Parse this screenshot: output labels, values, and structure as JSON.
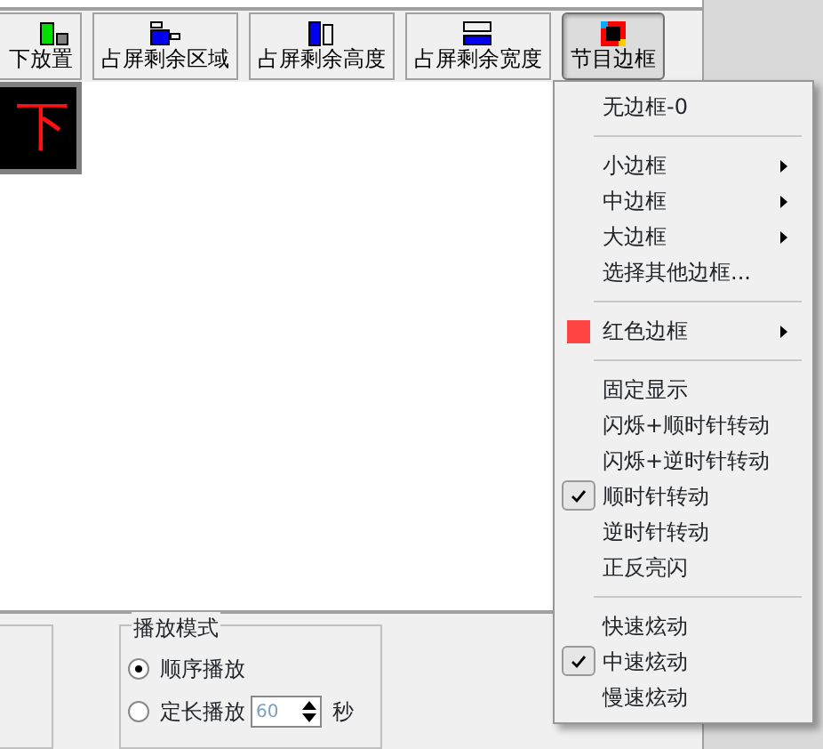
{
  "toolbar": {
    "buttons": [
      {
        "label": "下放置",
        "kind": "bottom",
        "selected": false
      },
      {
        "label": "占屏剩余区域",
        "kind": "fill-area",
        "selected": false
      },
      {
        "label": "占屏剩余高度",
        "kind": "fill-height",
        "selected": false
      },
      {
        "label": "占屏剩余宽度",
        "kind": "fill-width",
        "selected": false
      },
      {
        "label": "节目边框",
        "kind": "border",
        "selected": true
      }
    ]
  },
  "preview": {
    "text": "下"
  },
  "context_menu": {
    "items": [
      {
        "kind": "item",
        "label": "无边框-0",
        "checked": false
      },
      {
        "kind": "separator"
      },
      {
        "kind": "submenu",
        "label": "小边框",
        "checked": false
      },
      {
        "kind": "submenu",
        "label": "中边框",
        "checked": false
      },
      {
        "kind": "submenu",
        "label": "大边框",
        "checked": false
      },
      {
        "kind": "item",
        "label": "选择其他边框...",
        "checked": false
      },
      {
        "kind": "separator"
      },
      {
        "kind": "color-submenu",
        "label": "红色边框",
        "color": "#ff4444",
        "checked": false
      },
      {
        "kind": "separator"
      },
      {
        "kind": "item",
        "label": "固定显示",
        "checked": false
      },
      {
        "kind": "item",
        "label": "闪烁+顺时针转动",
        "checked": false
      },
      {
        "kind": "item",
        "label": "闪烁+逆时针转动",
        "checked": false
      },
      {
        "kind": "item",
        "label": "顺时针转动",
        "checked": true
      },
      {
        "kind": "item",
        "label": "逆时针转动",
        "checked": false
      },
      {
        "kind": "item",
        "label": "正反亮闪",
        "checked": false
      },
      {
        "kind": "separator"
      },
      {
        "kind": "item",
        "label": "快速炫动",
        "checked": false
      },
      {
        "kind": "item",
        "label": "中速炫动",
        "checked": true
      },
      {
        "kind": "item",
        "label": "慢速炫动",
        "checked": false
      }
    ]
  },
  "play_mode": {
    "title": "播放模式",
    "options": [
      {
        "label": "顺序播放",
        "selected": true
      },
      {
        "label": "定长播放",
        "selected": false
      }
    ],
    "duration": {
      "value": "60",
      "unit": "秒"
    }
  }
}
